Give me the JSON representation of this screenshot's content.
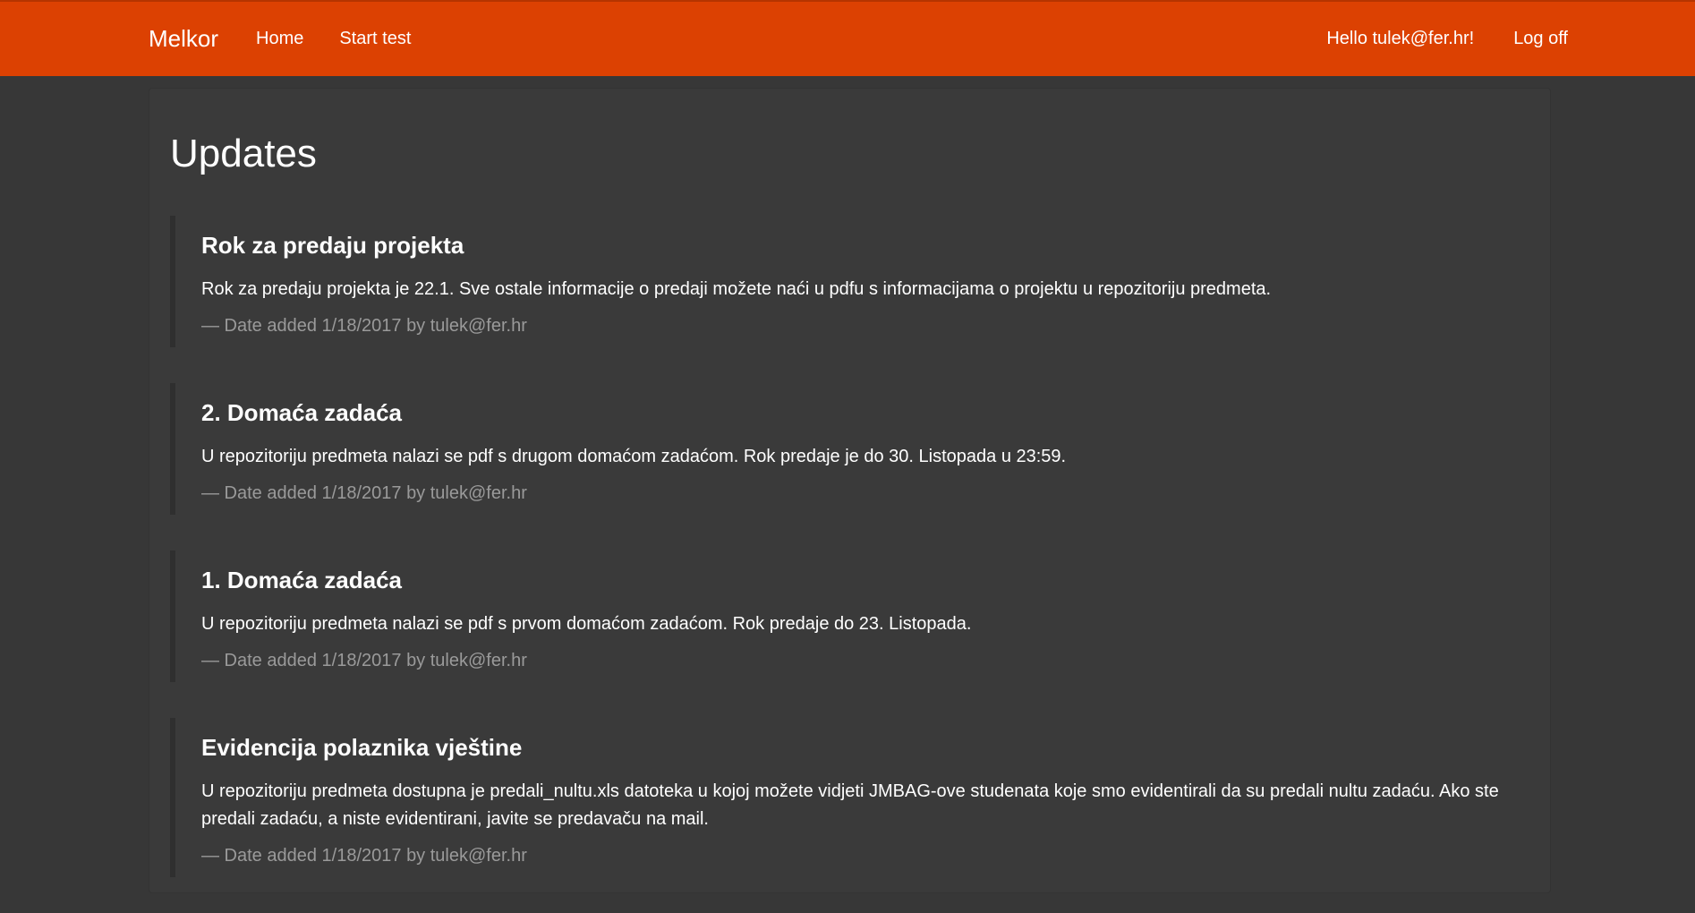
{
  "navbar": {
    "brand": "Melkor",
    "links": [
      {
        "label": "Home"
      },
      {
        "label": "Start test"
      }
    ],
    "greeting": "Hello tulek@fer.hr!",
    "logoff": "Log off",
    "color": "#dc4102"
  },
  "page": {
    "title": "Updates"
  },
  "updates": [
    {
      "title": "Rok za predaju projekta",
      "body": "Rok za predaju projekta je 22.1. Sve ostale informacije o predaji možete naći u pdfu s informacijama o projektu u repozitoriju predmeta.",
      "meta": "— Date added 1/18/2017 by tulek@fer.hr"
    },
    {
      "title": "2. Domaća zadaća",
      "body": "U repozitoriju predmeta nalazi se pdf s drugom domaćom zadaćom. Rok predaje je do 30. Listopada u 23:59.",
      "meta": "— Date added 1/18/2017 by tulek@fer.hr"
    },
    {
      "title": "1. Domaća zadaća",
      "body": "U repozitoriju predmeta nalazi se pdf s prvom domaćom zadaćom. Rok predaje do 23. Listopada.",
      "meta": "— Date added 1/18/2017 by tulek@fer.hr"
    },
    {
      "title": "Evidencija polaznika vještine",
      "body": "U repozitoriju predmeta dostupna je predali_nultu.xls datoteka u kojoj možete vidjeti JMBAG-ove studenata koje smo evidentirali da su predali nultu zadaću. Ako ste predali zadaću, a niste evidentirani, javite se predavaču na mail.",
      "meta": "— Date added 1/18/2017 by tulek@fer.hr"
    }
  ]
}
